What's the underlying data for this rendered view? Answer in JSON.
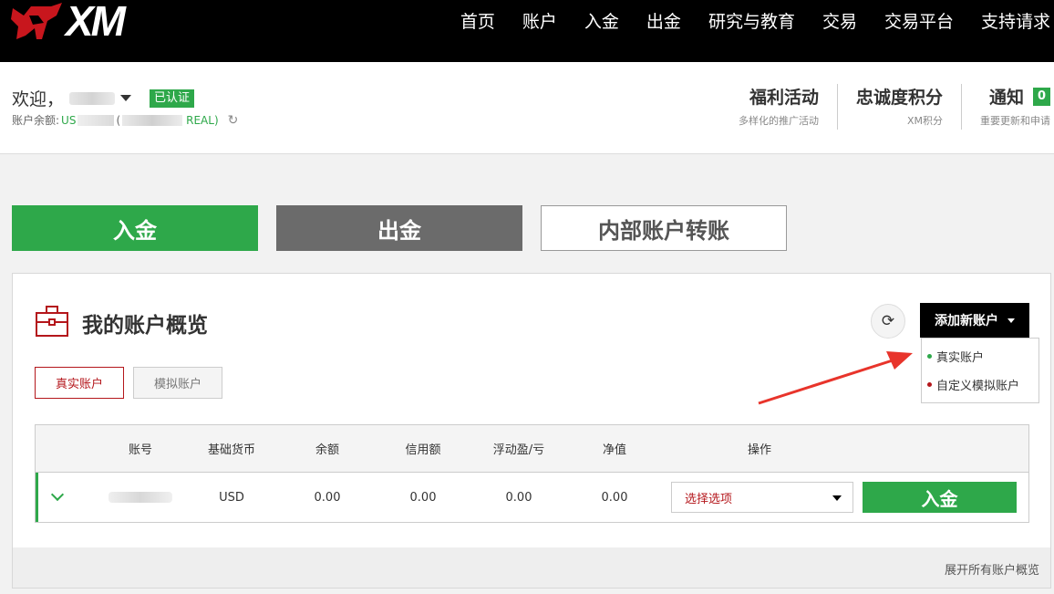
{
  "brand": {
    "logo_text": "XM",
    "accent": "#2ea84a",
    "danger": "#b4161b"
  },
  "nav": [
    "首页",
    "账户",
    "入金",
    "出金",
    "研究与教育",
    "交易",
    "交易平台",
    "支持请求"
  ],
  "welcome": {
    "greeting": "欢迎，",
    "verified": "已认证",
    "balance_label": "账户余额:",
    "balance_prefix": "US",
    "balance_paren": "(",
    "balance_suffix": "REAL)"
  },
  "header_links": [
    {
      "title": "福利活动",
      "sub": "多样化的推广活动"
    },
    {
      "title": "忠诚度积分",
      "sub": "XM积分"
    },
    {
      "title": "通知",
      "sub": "重要更新和申请",
      "count": "0"
    }
  ],
  "actions": {
    "deposit": "入金",
    "withdraw": "出金",
    "transfer": "内部账户转账"
  },
  "overview": {
    "title": "我的账户概览",
    "add_account": "添加新账户",
    "dropdown": [
      "真实账户",
      "自定义模拟账户"
    ],
    "tabs": [
      "真实账户",
      "模拟账户"
    ],
    "columns": [
      "账号",
      "基础货币",
      "余额",
      "信用额",
      "浮动盈/亏",
      "净值",
      "操作"
    ],
    "rows": [
      {
        "currency": "USD",
        "balance": "0.00",
        "credit": "0.00",
        "pnl": "0.00",
        "equity": "0.00",
        "select": "选择选项",
        "deposit": "入金"
      }
    ],
    "expand": "展开所有账户概览"
  }
}
